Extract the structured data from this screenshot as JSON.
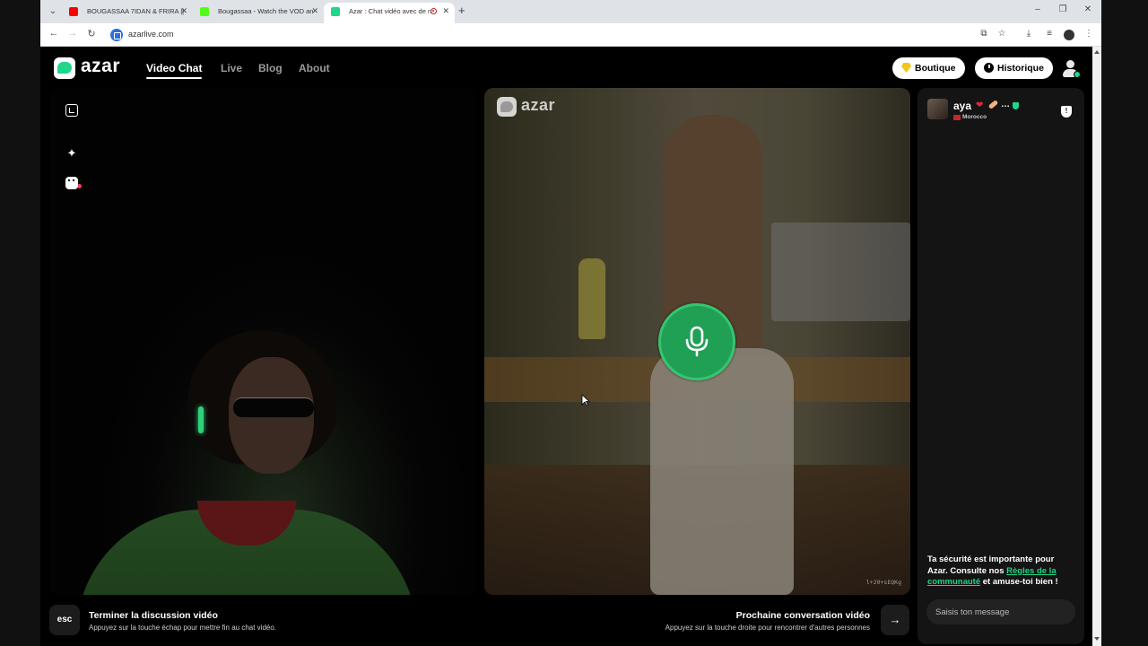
{
  "browser": {
    "tabs": [
      {
        "title": "BOUGASSAA 7IDAN & FRIRA ||",
        "favicon_color": "#ff0000"
      },
      {
        "title": "Bougassaa - Watch the VOD an",
        "favicon_color": "#53fc18"
      },
      {
        "title": "Azar : Chat vidéo avec de n",
        "favicon_color": "#1fd68a"
      }
    ],
    "url": "azarlive.com",
    "new_tab": "+",
    "win_minimize": "–",
    "win_restore": "❐",
    "win_close": "✕"
  },
  "app": {
    "logo_text": "azar",
    "nav": [
      "Video Chat",
      "Live",
      "Blog",
      "About"
    ],
    "boutique_label": "Boutique",
    "historique_label": "Historique"
  },
  "peer": {
    "name": "aya",
    "heart": "❤",
    "ellipsis": "…",
    "country": "Morocco"
  },
  "chat": {
    "safety_text_1": "Ta sécurité est importante pour Azar. Consulte nos ",
    "safety_link": "Règles de la communauté",
    "safety_text_2": " et amuse-toi bien !",
    "input_placeholder": "Saisis ton message"
  },
  "controls": {
    "esc_label": "esc",
    "end_title": "Terminer la discussion vidéo",
    "end_sub": "Appuyez sur la touche échap pour mettre fin au chat vidéo.",
    "next_title": "Prochaine conversation vidéo",
    "next_sub": "Appuyez sur la touche droite pour rencontrer d'autres personnes",
    "arrow": "→"
  },
  "video": {
    "watermark": "l+20+sEQKg",
    "mid_logo_text": "azar"
  },
  "colors": {
    "accent": "#1fd68a",
    "mic_green": "#1fa055",
    "report_red": "#e8233e"
  }
}
